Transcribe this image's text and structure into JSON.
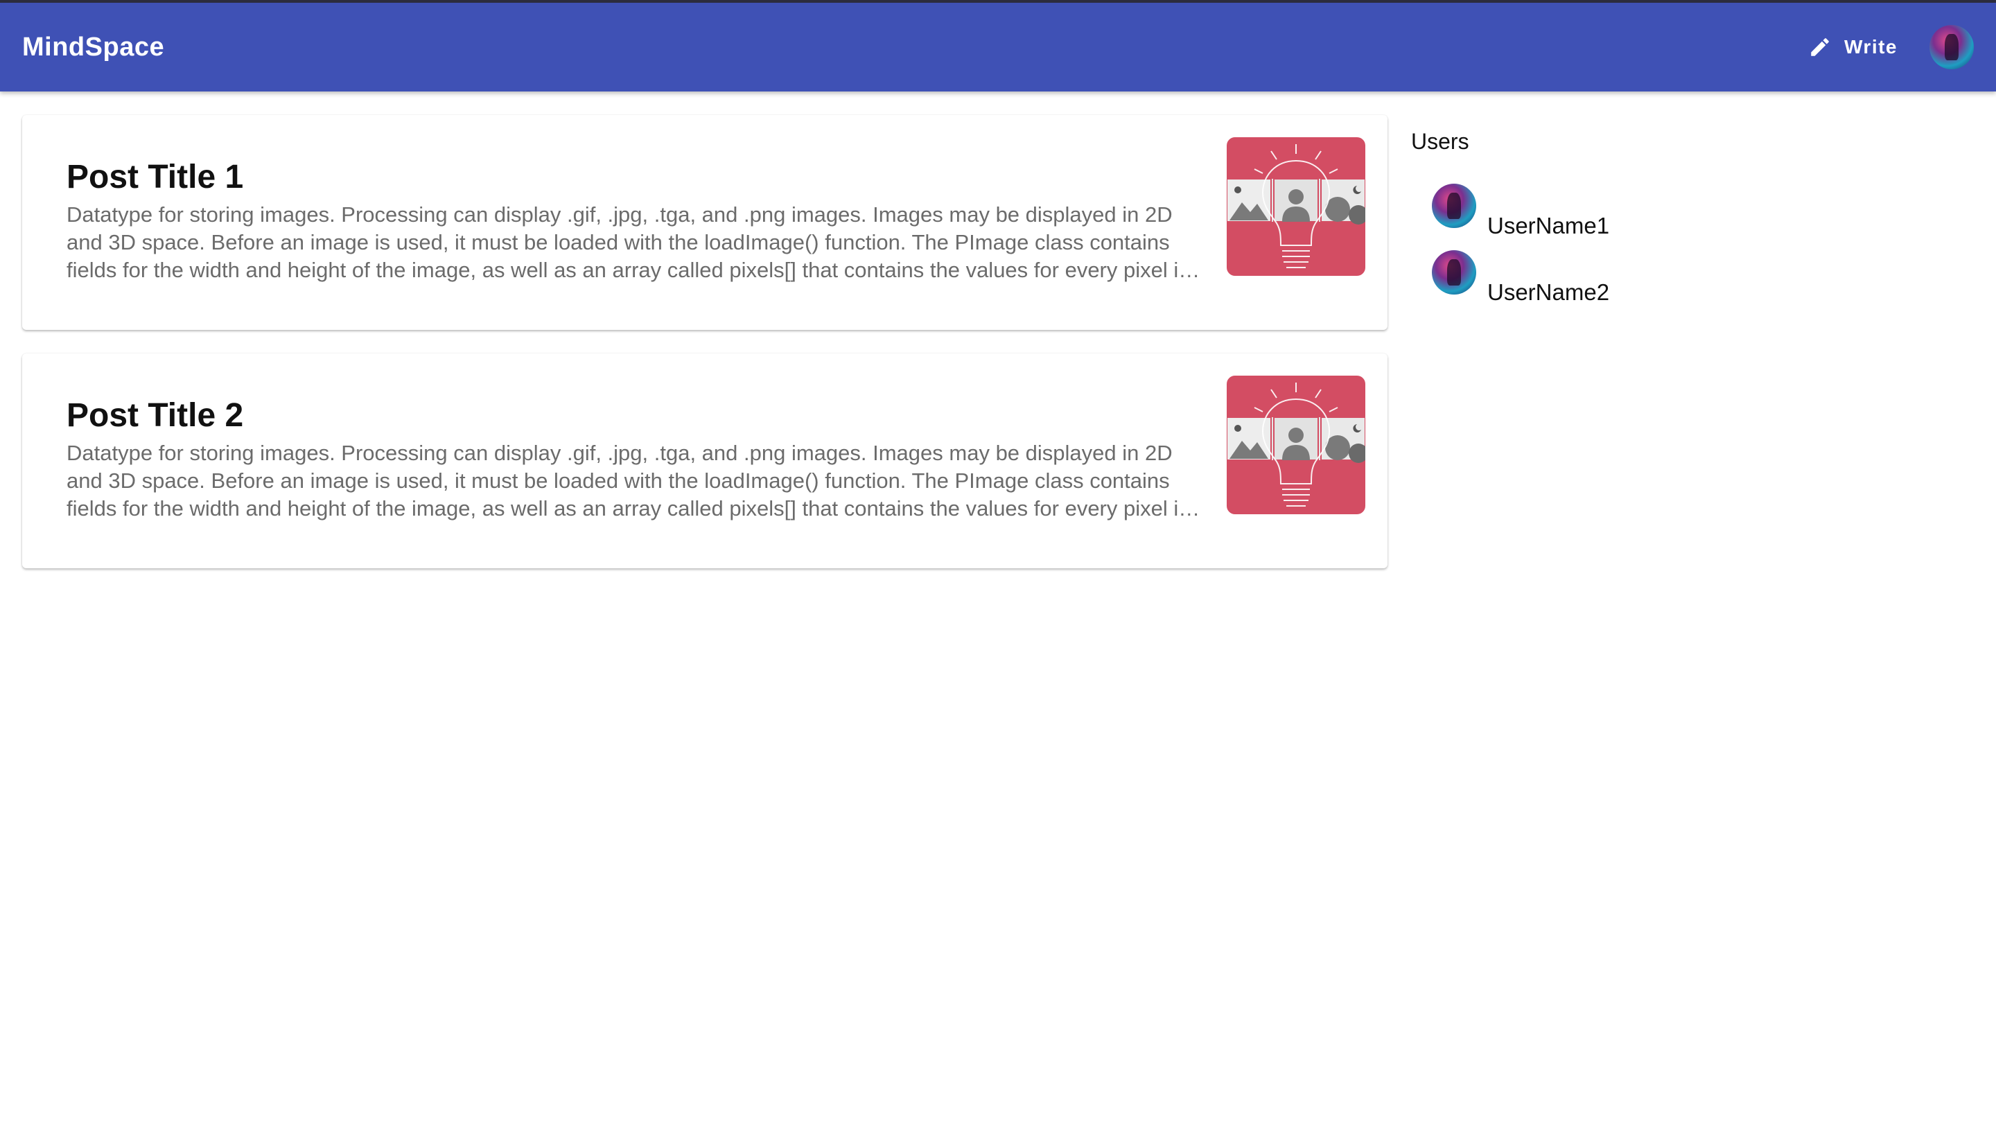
{
  "app": {
    "title": "MindSpace"
  },
  "header": {
    "write_label": "Write",
    "write_icon": "pencil-icon",
    "avatar_icon": "avatar"
  },
  "colors": {
    "appbar": "#3f51b5",
    "thumbnail": "#d34d63"
  },
  "posts": [
    {
      "title": "Post Title 1",
      "excerpt": "Datatype for storing images. Processing can display .gif, .jpg, .tga, and .png images. Images may be displayed in 2D and 3D space. Before an image is used, it must be loaded with the loadImage() function. The PImage class contains fields for the width and height of the image, as well as an array called pixels[] that contains the values for every pixel in the image.",
      "thumbnail_icon": "lightbulb-image-placeholder-icon"
    },
    {
      "title": "Post Title 2",
      "excerpt": "Datatype for storing images. Processing can display .gif, .jpg, .tga, and .png images. Images may be displayed in 2D and 3D space. Before an image is used, it must be loaded with the loadImage() function. The PImage class contains fields for the width and height of the image, as well as an array called pixels[] that contains the values for every pixel in the image.",
      "thumbnail_icon": "lightbulb-image-placeholder-icon"
    }
  ],
  "sidebar": {
    "title": "Users",
    "users": [
      {
        "name": "UserName1"
      },
      {
        "name": "UserName2"
      }
    ]
  }
}
